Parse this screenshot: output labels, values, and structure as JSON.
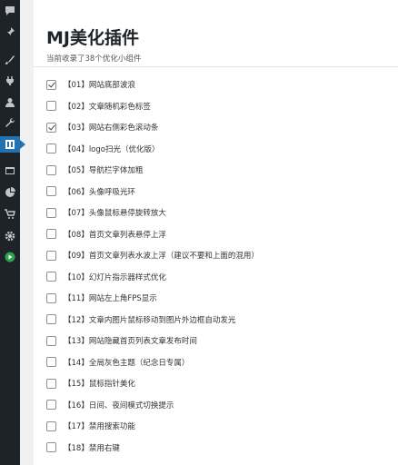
{
  "sidebar": {
    "icons": [
      {
        "name": "comment-icon",
        "active": false
      },
      {
        "name": "pin-icon",
        "active": false
      },
      {
        "name": "appearance-icon",
        "active": false
      },
      {
        "name": "plugins-icon",
        "active": false
      },
      {
        "name": "users-icon",
        "active": false
      },
      {
        "name": "tools-icon",
        "active": false
      },
      {
        "name": "settings-icon",
        "active": true
      },
      {
        "name": "media-icon",
        "active": false
      },
      {
        "name": "chart-icon",
        "active": false
      },
      {
        "name": "cart-icon",
        "active": false
      },
      {
        "name": "gear-icon",
        "active": false
      },
      {
        "name": "play-icon",
        "active": false
      }
    ],
    "active_color": "#2271b1",
    "play_color": "#2ea44f"
  },
  "page": {
    "title": "MJ美化插件",
    "subtitle": "当前收录了38个优化小组件"
  },
  "widgets": [
    {
      "label": "【01】网站底部波浪",
      "checked": true
    },
    {
      "label": "【02】文章随机彩色标签",
      "checked": false
    },
    {
      "label": "【03】网站右侧彩色滚动条",
      "checked": true
    },
    {
      "label": "【04】logo扫光（优化版）",
      "checked": false
    },
    {
      "label": "【05】导航栏字体加粗",
      "checked": false
    },
    {
      "label": "【06】头像呼吸光环",
      "checked": false
    },
    {
      "label": "【07】头像鼠标悬停旋转放大",
      "checked": false
    },
    {
      "label": "【08】首页文章列表悬停上浮",
      "checked": false
    },
    {
      "label": "【09】首页文章列表水波上浮（建议不要和上面的混用）",
      "checked": false
    },
    {
      "label": "【10】幻灯片指示器样式优化",
      "checked": false
    },
    {
      "label": "【11】网站左上角FPS显示",
      "checked": false
    },
    {
      "label": "【12】文章内图片鼠标移动到图片外边框自动发光",
      "checked": false
    },
    {
      "label": "【13】网站隐藏首页列表文章发布时间",
      "checked": false
    },
    {
      "label": "【14】全局灰色主题（纪念日专属）",
      "checked": false
    },
    {
      "label": "【15】鼠标指针美化",
      "checked": false
    },
    {
      "label": "【16】日间、夜间模式切换提示",
      "checked": false
    },
    {
      "label": "【17】禁用搜索功能",
      "checked": false
    },
    {
      "label": "【18】禁用右键",
      "checked": false
    }
  ]
}
